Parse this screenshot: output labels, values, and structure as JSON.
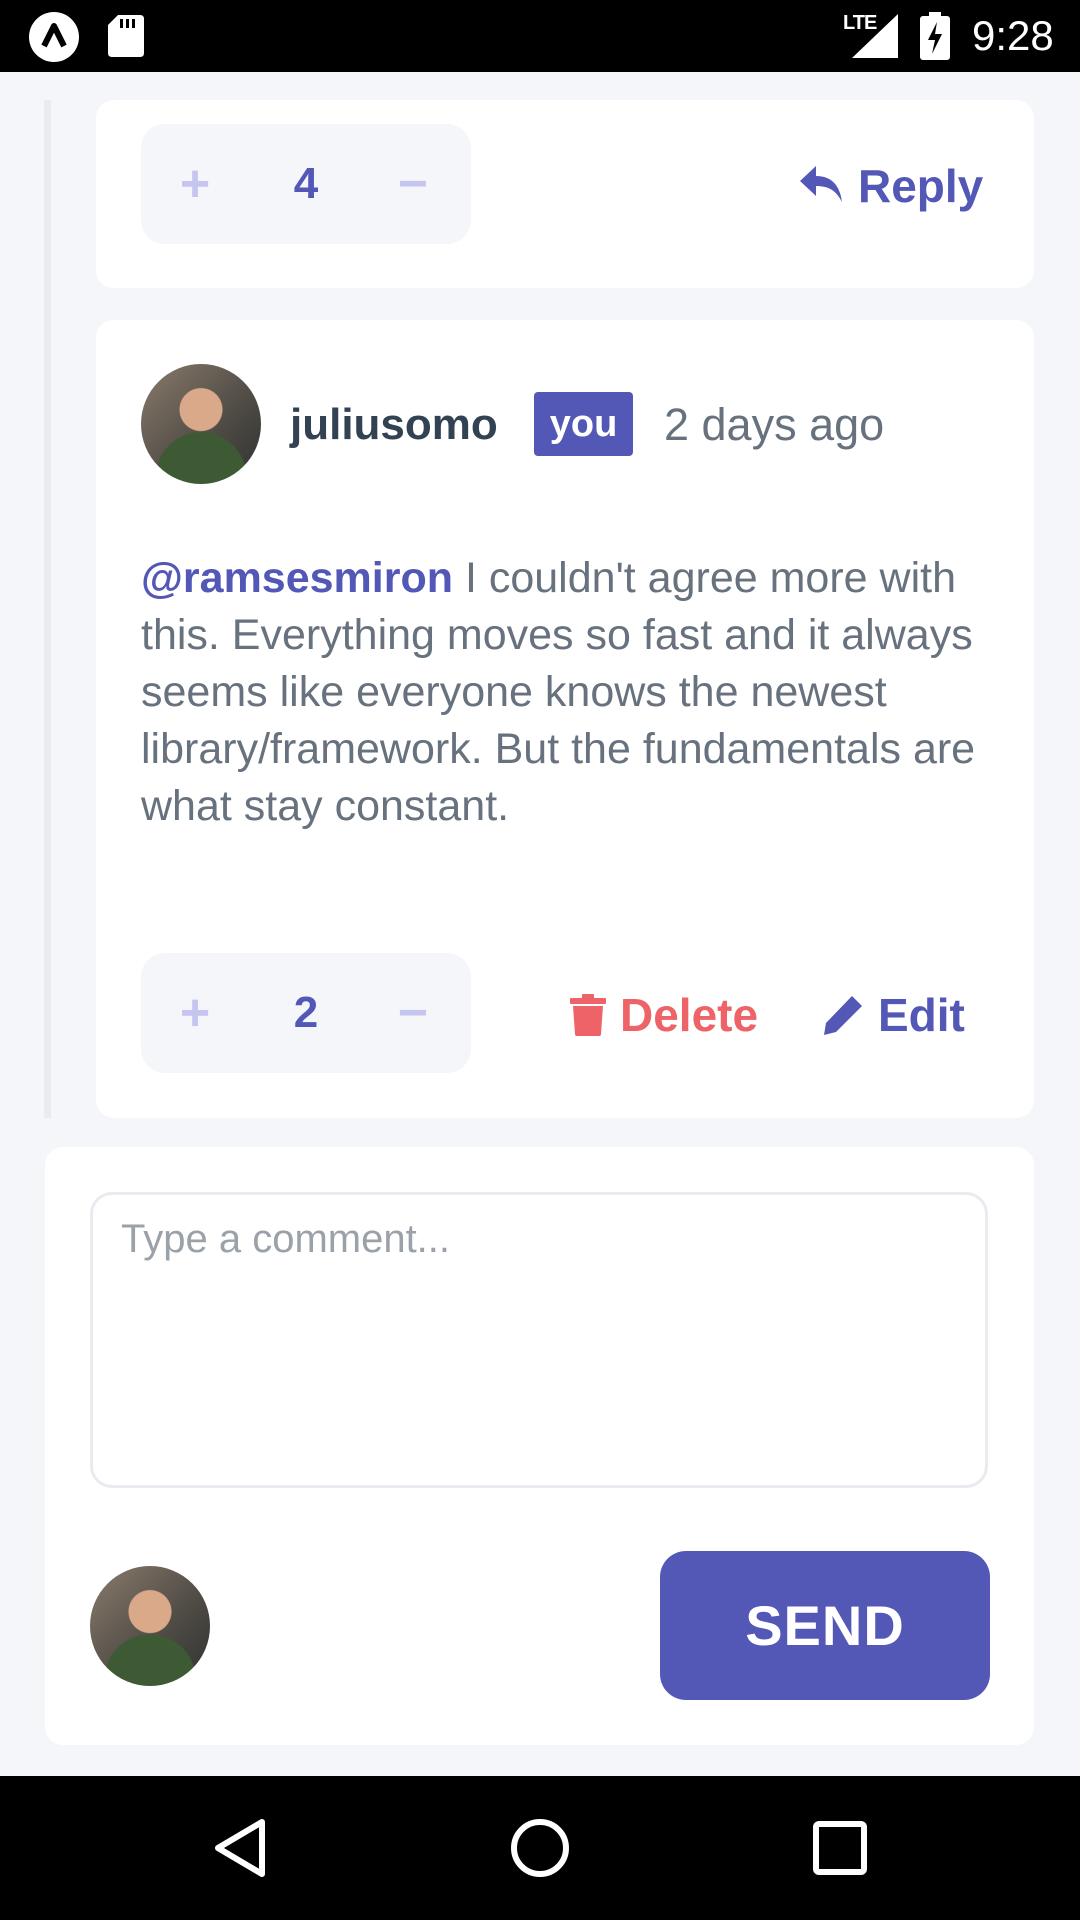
{
  "status_bar": {
    "network": "LTE",
    "time": "9:28",
    "icons": [
      "app-icon",
      "sd-card-icon",
      "signal-icon",
      "battery-charging-icon"
    ]
  },
  "parent_comment": {
    "score": "4",
    "plus_icon": "plus-icon",
    "minus_icon": "minus-icon",
    "reply_label": "Reply",
    "reply_icon": "reply-arrow-icon"
  },
  "reply_comment": {
    "username": "juliusomo",
    "badge": "you",
    "timestamp": "2 days ago",
    "mention": "@ramsesmiron",
    "text": " I couldn't agree more with this. Everything moves so fast and it always seems like everyone knows the newest library/framework. But the fundamentals are what stay constant.",
    "score": "2",
    "delete_label": "Delete",
    "delete_icon": "trash-icon",
    "edit_label": "Edit",
    "edit_icon": "pencil-icon"
  },
  "new_comment": {
    "placeholder": "Type a comment...",
    "value": "",
    "send_label": "SEND"
  },
  "colors": {
    "accent": "#5357b6",
    "danger": "#ed6368",
    "text": "#67727e",
    "heading": "#334253",
    "page_bg": "#f5f6fa",
    "light_accent": "#c5c6ef"
  },
  "nav_bar": {
    "icons": [
      "back-icon",
      "home-icon",
      "recents-icon"
    ]
  }
}
